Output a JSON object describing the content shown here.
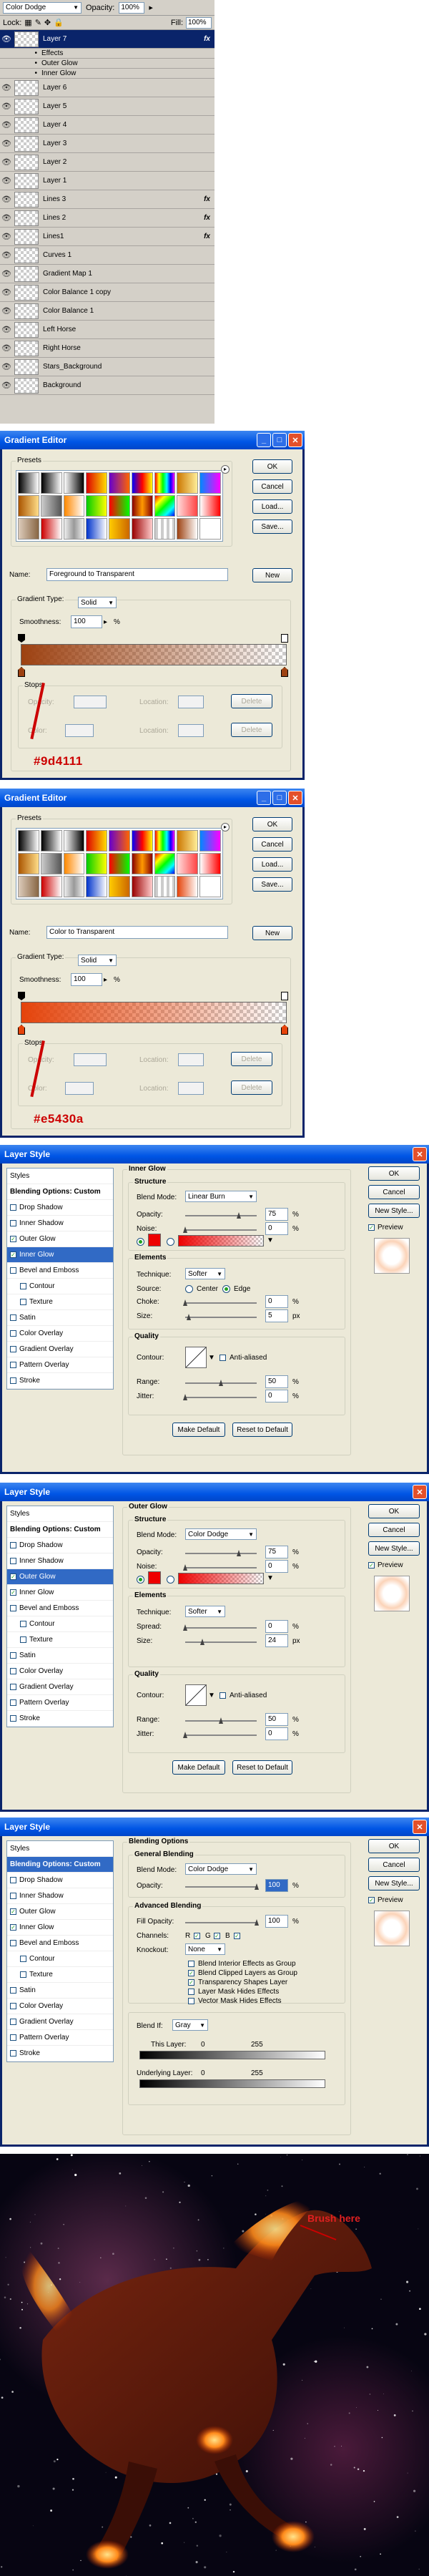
{
  "layers_panel": {
    "blend_mode": "Color Dodge",
    "opacity_label": "Opacity:",
    "opacity_value": "100%",
    "lock_label": "Lock:",
    "fill_label": "Fill:",
    "fill_value": "100%",
    "rows": [
      {
        "name": "Layer 7",
        "fx": "fx",
        "selected": true
      },
      {
        "name": "Effects",
        "sub": true
      },
      {
        "name": "Outer Glow",
        "sub": true
      },
      {
        "name": "Inner Glow",
        "sub": true
      },
      {
        "name": "Layer 6"
      },
      {
        "name": "Layer 5"
      },
      {
        "name": "Layer 4"
      },
      {
        "name": "Layer 3"
      },
      {
        "name": "Layer 2"
      },
      {
        "name": "Layer 1"
      },
      {
        "name": "Lines 3",
        "fx": "fx"
      },
      {
        "name": "Lines 2",
        "fx": "fx"
      },
      {
        "name": "Lines1",
        "fx": "fx"
      },
      {
        "name": "Curves 1"
      },
      {
        "name": "Gradient Map 1"
      },
      {
        "name": "Color Balance 1 copy"
      },
      {
        "name": "Color Balance 1"
      },
      {
        "name": "Left Horse"
      },
      {
        "name": "Right Horse"
      },
      {
        "name": "Stars_Background"
      },
      {
        "name": "Background"
      }
    ]
  },
  "gradient_editor_1": {
    "title": "Gradient Editor",
    "presets_label": "Presets",
    "buttons": [
      "OK",
      "Cancel",
      "Load...",
      "Save..."
    ],
    "name_label": "Name:",
    "name_value": "Foreground to Transparent",
    "new_label": "New",
    "type_label": "Gradient Type:",
    "type_value": "Solid",
    "smooth_label": "Smoothness:",
    "smooth_value": "100",
    "pct": "%",
    "stops_label": "Stops",
    "opacity_label": "Opacity:",
    "location_label": "Location:",
    "color_label": "Color:",
    "delete_label": "Delete",
    "color_hex": "#9d4111",
    "color": "#9d4111"
  },
  "gradient_editor_2": {
    "title": "Gradient Editor",
    "presets_label": "Presets",
    "buttons": [
      "OK",
      "Cancel",
      "Load...",
      "Save..."
    ],
    "name_label": "Name:",
    "name_value": "Color to Transparent",
    "new_label": "New",
    "type_label": "Gradient Type:",
    "type_value": "Solid",
    "smooth_label": "Smoothness:",
    "smooth_value": "100",
    "pct": "%",
    "stops_label": "Stops",
    "opacity_label": "Opacity:",
    "location_label": "Location:",
    "color_label": "Color:",
    "delete_label": "Delete",
    "color_hex": "#e5430a",
    "color": "#e5430a"
  },
  "layer_style_inner": {
    "title": "Layer Style",
    "list": [
      "Styles",
      "Blending Options: Custom",
      "Drop Shadow",
      "Inner Shadow",
      "Outer Glow",
      "Inner Glow",
      "Bevel and Emboss",
      "Contour",
      "Texture",
      "Satin",
      "Color Overlay",
      "Gradient Overlay",
      "Pattern Overlay",
      "Stroke"
    ],
    "checked": [
      4,
      5
    ],
    "active": 5,
    "section": "Inner Glow",
    "structure": "Structure",
    "blend_label": "Blend Mode:",
    "blend_value": "Linear Burn",
    "opacity_label": "Opacity:",
    "opacity_value": "75",
    "noise_label": "Noise:",
    "noise_value": "0",
    "elements": "Elements",
    "technique_label": "Technique:",
    "technique_value": "Softer",
    "source_label": "Source:",
    "center_label": "Center",
    "edge_label": "Edge",
    "choke_label": "Choke:",
    "choke_value": "0",
    "size_label": "Size:",
    "size_value": "5",
    "px": "px",
    "quality": "Quality",
    "contour_label": "Contour:",
    "antialiased_label": "Anti-aliased",
    "range_label": "Range:",
    "range_value": "50",
    "jitter_label": "Jitter:",
    "jitter_value": "0",
    "make_default": "Make Default",
    "reset_default": "Reset to Default",
    "buttons": [
      "OK",
      "Cancel",
      "New Style...",
      "Preview"
    ]
  },
  "layer_style_outer": {
    "title": "Layer Style",
    "list": [
      "Styles",
      "Blending Options: Custom",
      "Drop Shadow",
      "Inner Shadow",
      "Outer Glow",
      "Inner Glow",
      "Bevel and Emboss",
      "Contour",
      "Texture",
      "Satin",
      "Color Overlay",
      "Gradient Overlay",
      "Pattern Overlay",
      "Stroke"
    ],
    "checked": [
      4,
      5
    ],
    "active": 4,
    "section": "Outer Glow",
    "structure": "Structure",
    "blend_label": "Blend Mode:",
    "blend_value": "Color Dodge",
    "opacity_label": "Opacity:",
    "opacity_value": "75",
    "noise_label": "Noise:",
    "noise_value": "0",
    "elements": "Elements",
    "technique_label": "Technique:",
    "technique_value": "Softer",
    "spread_label": "Spread:",
    "spread_value": "0",
    "size_label": "Size:",
    "size_value": "24",
    "px": "px",
    "quality": "Quality",
    "contour_label": "Contour:",
    "antialiased_label": "Anti-aliased",
    "range_label": "Range:",
    "range_value": "50",
    "jitter_label": "Jitter:",
    "jitter_value": "0",
    "make_default": "Make Default",
    "reset_default": "Reset to Default",
    "buttons": [
      "OK",
      "Cancel",
      "New Style...",
      "Preview"
    ]
  },
  "layer_style_blend": {
    "title": "Layer Style",
    "list": [
      "Styles",
      "Blending Options: Custom",
      "Drop Shadow",
      "Inner Shadow",
      "Outer Glow",
      "Inner Glow",
      "Bevel and Emboss",
      "Contour",
      "Texture",
      "Satin",
      "Color Overlay",
      "Gradient Overlay",
      "Pattern Overlay",
      "Stroke"
    ],
    "checked": [
      4,
      5
    ],
    "active": 1,
    "section": "Blending Options",
    "general": "General Blending",
    "blend_label": "Blend Mode:",
    "blend_value": "Color Dodge",
    "opacity_label": "Opacity:",
    "opacity_value": "100",
    "advanced": "Advanced Blending",
    "fill_label": "Fill Opacity:",
    "fill_value": "100",
    "channels_label": "Channels:",
    "channels": [
      "R",
      "G",
      "B"
    ],
    "knockout_label": "Knockout:",
    "knockout_value": "None",
    "options": [
      "Blend Interior Effects as Group",
      "Blend Clipped Layers as Group",
      "Transparency Shapes Layer",
      "Layer Mask Hides Effects",
      "Vector Mask Hides Effects"
    ],
    "options_checked": [
      1,
      2
    ],
    "blendif_label": "Blend If:",
    "blendif_value": "Gray",
    "this_layer": "This Layer:",
    "underlying": "Underlying Layer:",
    "range_min": "0",
    "range_max": "255",
    "buttons": [
      "OK",
      "Cancel",
      "New Style...",
      "Preview"
    ]
  },
  "horse": {
    "label": "Brush here"
  }
}
